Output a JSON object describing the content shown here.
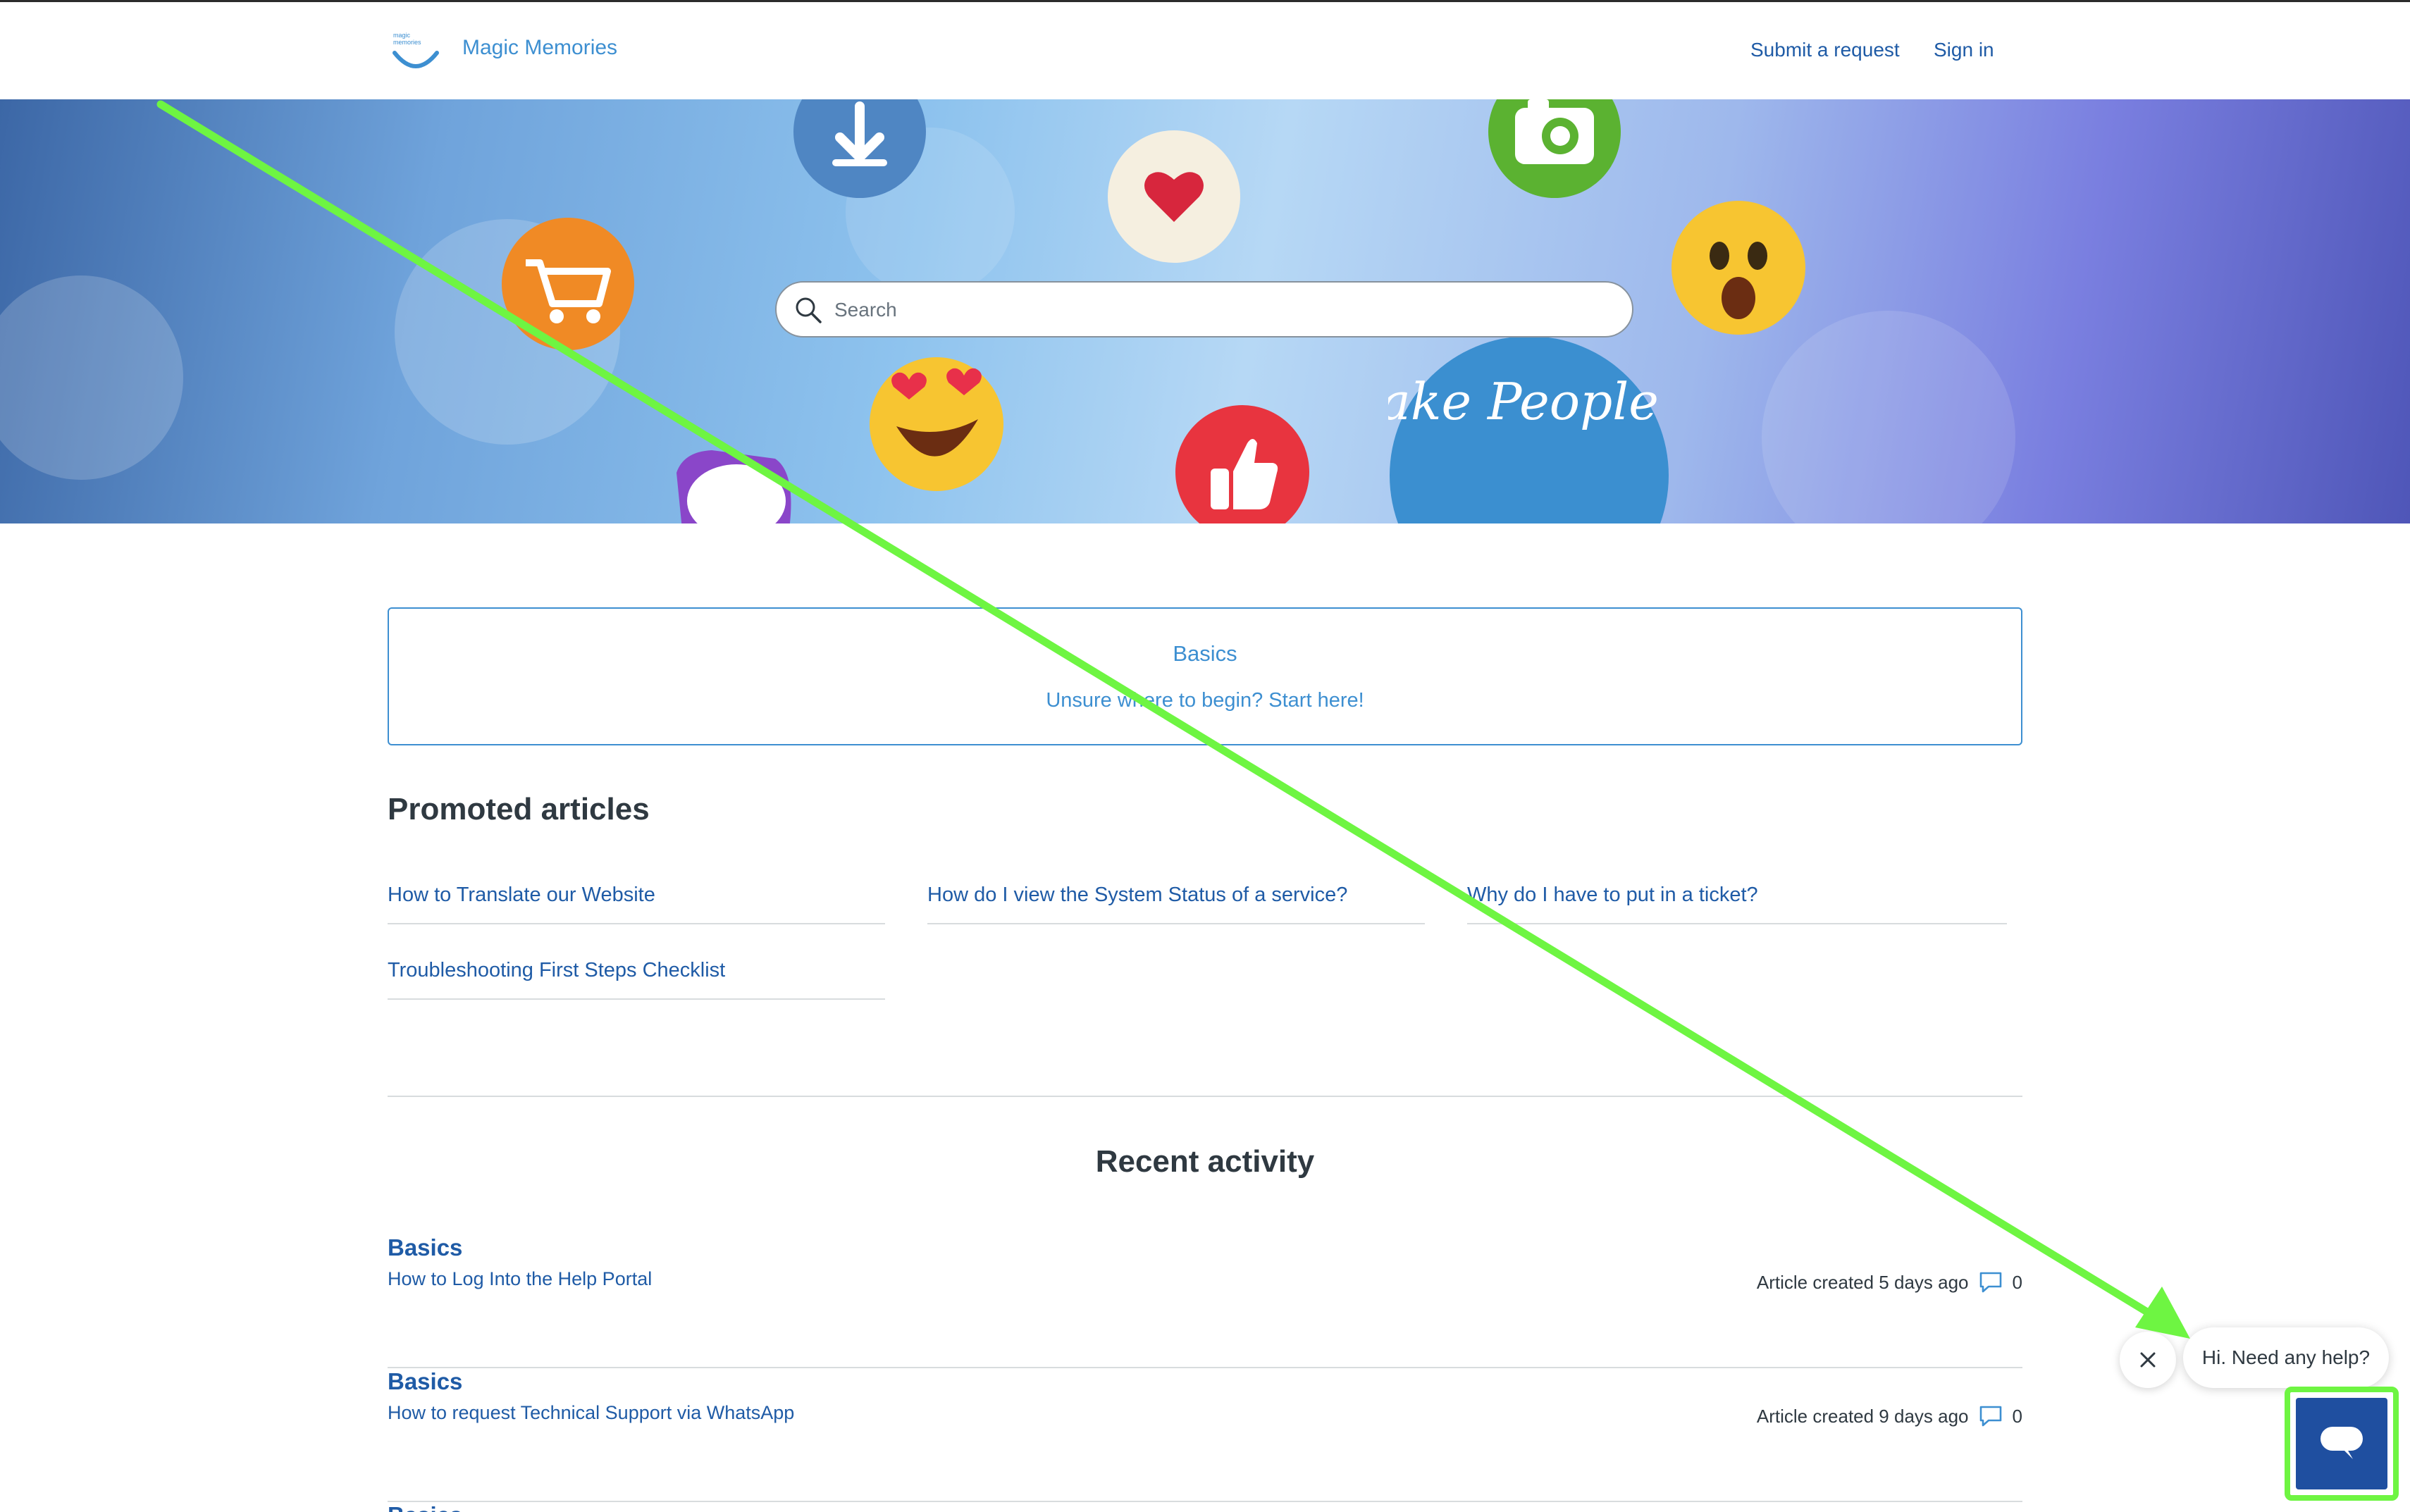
{
  "header": {
    "brand_name": "Magic Memories",
    "logo_text": "magic memories",
    "nav": {
      "submit_request": "Submit a request",
      "sign_in": "Sign in"
    }
  },
  "hero": {
    "search_placeholder": "Search",
    "badge_text": "We make People Smile",
    "icons": [
      "download-icon",
      "heart-icon",
      "camera-icon",
      "cart-icon",
      "surprised-emoji-icon",
      "heart-eyes-emoji-icon",
      "thumbs-up-icon",
      "speech-bubble-icon"
    ]
  },
  "category": {
    "title": "Basics",
    "description": "Unsure where to begin? Start here!"
  },
  "promoted": {
    "heading": "Promoted articles",
    "articles": [
      "How to Translate our Website",
      "How do I view the System Status of a service?",
      "Why do I have to put in a ticket?",
      "Troubleshooting First Steps Checklist"
    ]
  },
  "recent": {
    "heading": "Recent activity",
    "items": [
      {
        "category": "Basics",
        "title": "How to Log Into the Help Portal",
        "meta": "Article created 5 days ago",
        "comments": "0"
      },
      {
        "category": "Basics",
        "title": "How to request Technical Support via WhatsApp",
        "meta": "Article created 9 days ago",
        "comments": "0"
      },
      {
        "category": "Basics",
        "title": "",
        "meta": "",
        "comments": ""
      }
    ]
  },
  "chat": {
    "greeting": "Hi. Need any help?"
  },
  "colors": {
    "link": "#1f5ba6",
    "accent": "#3d8fd1",
    "launcher": "#1f4fa0",
    "annotation": "#6ef542"
  }
}
